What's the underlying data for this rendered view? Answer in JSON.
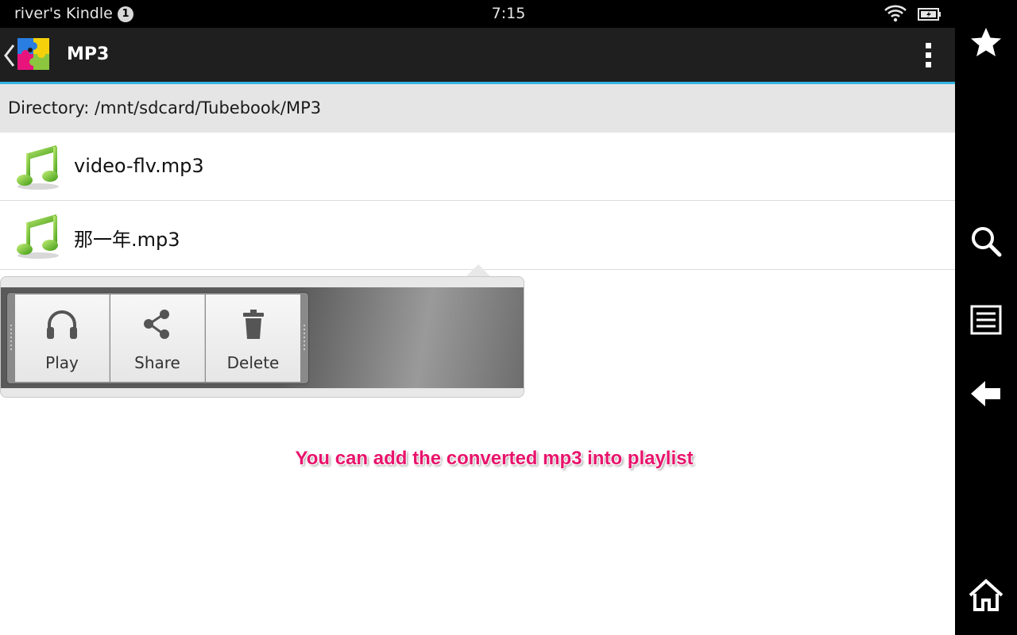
{
  "status_bar": {
    "device_name": "river's Kindle",
    "notification_count": "1",
    "time": "7:15",
    "icons": [
      "wifi-icon",
      "battery-icon"
    ]
  },
  "action_bar": {
    "title": "MP3",
    "icons": [
      "back-chevron-icon",
      "app-puzzle-icon",
      "overflow-menu-icon"
    ]
  },
  "directory": {
    "label": "Directory: /mnt/sdcard/Tubebook/MP3"
  },
  "files": [
    {
      "name": "video-flv.mp3",
      "icon": "music-note-icon"
    },
    {
      "name": "那一年.mp3",
      "icon": "music-note-icon"
    }
  ],
  "quick_actions": [
    {
      "label": "Play",
      "icon": "headphones-icon"
    },
    {
      "label": "Share",
      "icon": "share-icon"
    },
    {
      "label": "Delete",
      "icon": "trash-icon"
    }
  ],
  "caption": "You can add the converted mp3 into playlist",
  "nav_bar": {
    "icons": [
      "star-icon",
      "search-icon",
      "menu-list-icon",
      "back-arrow-icon",
      "home-icon"
    ]
  },
  "colors": {
    "accent": "#33b5e5",
    "caption": "#e8146c",
    "action_bar": "#1f1f1f"
  }
}
